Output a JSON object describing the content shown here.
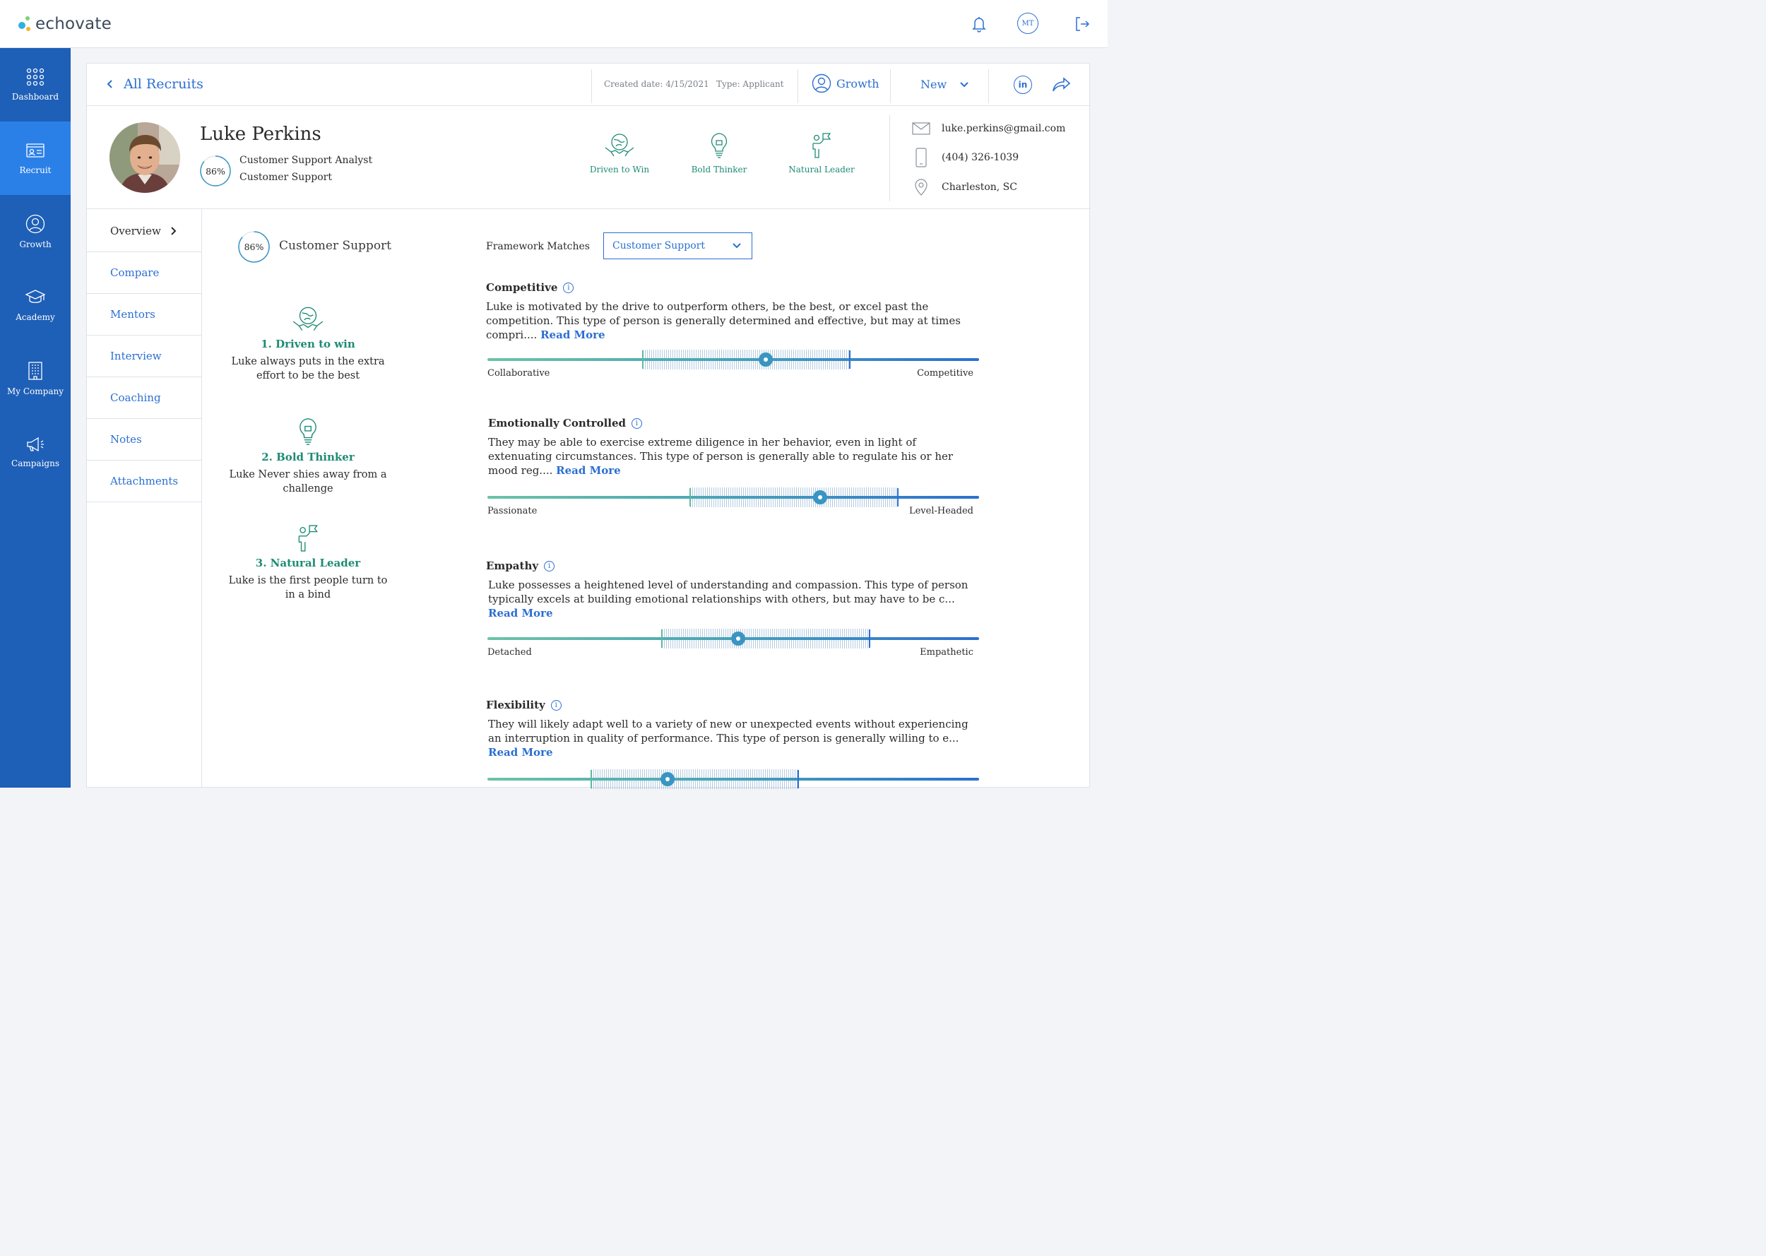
{
  "app": {
    "logo_text": "echovate",
    "avatar_initials": "MT"
  },
  "sidebar": {
    "items": [
      {
        "label": "Dashboard",
        "icon": "grid-dots-icon"
      },
      {
        "label": "Recruit",
        "icon": "id-card-icon",
        "active": true
      },
      {
        "label": "Growth",
        "icon": "person-circle-icon"
      },
      {
        "label": "Academy",
        "icon": "graduation-cap-icon"
      },
      {
        "label": "My Company",
        "icon": "building-icon"
      },
      {
        "label": "Campaigns",
        "icon": "megaphone-icon"
      }
    ]
  },
  "header": {
    "back_label": "All Recruits",
    "created": "Created date: 4/15/2021",
    "type": "Type: Applicant",
    "growth_label": "Growth",
    "status_label": "New",
    "linkedin_label": "in"
  },
  "profile": {
    "name": "Luke Perkins",
    "match": "86%",
    "match_value": 86,
    "title": "Customer Support Analyst",
    "department": "Customer Support",
    "badges": [
      "Driven to Win",
      "Bold Thinker",
      "Natural Leader"
    ],
    "email": "luke.perkins@gmail.com",
    "phone": "(404) 326-1039",
    "location": "Charleston, SC"
  },
  "menu": [
    "Overview",
    "Compare",
    "Mentors",
    "Interview",
    "Coaching",
    "Notes",
    "Attachments"
  ],
  "framework": {
    "match": "86%",
    "match_value": 86,
    "name": "Customer Support",
    "label": "Framework Matches",
    "selected": "Customer Support"
  },
  "strengths": [
    {
      "title": "1. Driven to win",
      "desc": "Luke always puts in the extra effort to be the best"
    },
    {
      "title": "2. Bold Thinker",
      "desc": "Luke Never shies away from a challenge"
    },
    {
      "title": "3. Natural Leader",
      "desc": "Luke is the first people turn to in a bind"
    }
  ],
  "read_more": "Read More",
  "colors": {
    "primary": "#2b6fd1",
    "sidebar": "#1e5fb7",
    "sidebar_active": "#2b80e8",
    "green": "#1e8b75",
    "knob": "#3a95c2"
  },
  "traits": [
    {
      "title": "Competitive",
      "desc": "Luke is motivated by the drive to outperform others, be the best, or excel past the competition. This type of person is generally determined and effective, but may at times compri....",
      "left": "Collaborative",
      "right": "Competitive",
      "range": [
        0.316,
        0.737
      ],
      "value": 0.566
    },
    {
      "title": "Emotionally Controlled",
      "desc": "They may be able to exercise extreme diligence in her behavior, even in light of extenuating circumstances. This type of person is generally able to regulate his or her mood reg....",
      "left": "Passionate",
      "right": "Level-Headed",
      "range": [
        0.413,
        0.835
      ],
      "value": 0.677
    },
    {
      "title": "Empathy",
      "desc": "Luke possesses a heightened level of understanding and compassion. This type of person typically excels at building emotional relationships with others, but may have to be c...",
      "left": "Detached",
      "right": "Empathetic",
      "range": [
        0.355,
        0.777
      ],
      "value": 0.51
    },
    {
      "title": "Flexibility",
      "desc": "They will likely adapt well to a variety of new or unexpected events without experiencing an interruption in quality of performance. This type of person is generally willing to e...",
      "left": "",
      "right": "",
      "range": [
        0.211,
        0.632
      ],
      "value": 0.366
    }
  ]
}
